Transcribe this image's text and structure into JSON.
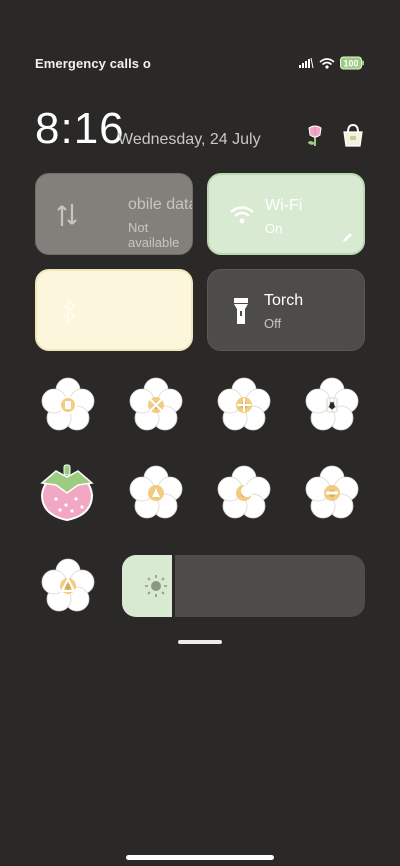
{
  "status": {
    "text": "Emergency calls o",
    "battery_label": "100"
  },
  "clock": {
    "time": "8:16",
    "date": "Wednesday, 24 July"
  },
  "tiles": {
    "mobile_data": {
      "label": "obile data",
      "sub": "Not available"
    },
    "wifi": {
      "label": "Wi-Fi",
      "sub": "On"
    },
    "bluetooth": {
      "label": "",
      "sub": ""
    },
    "torch": {
      "label": "Torch",
      "sub": "Off"
    }
  },
  "brightness": {
    "level_fraction": 0.22
  },
  "colors": {
    "background": "#2a2927",
    "wifi_tile": "#d9ead2",
    "bluetooth_tile": "#fcf6dc",
    "mobile_tile": "#82807a",
    "torch_tile": "#4d4c49",
    "flower_petal": "#ffffff",
    "flower_center": "#f0c46a",
    "strawberry": "#f2a7c3",
    "strawberry_leaf": "#9ccb82"
  },
  "quick_toggles": [
    {
      "icon": "power-saving-icon"
    },
    {
      "icon": "airplane-mode-icon"
    },
    {
      "icon": "location-icon"
    },
    {
      "icon": "screen-rotation-icon"
    },
    {
      "icon": "strawberry-sticker-icon"
    },
    {
      "icon": "hotspot-icon"
    },
    {
      "icon": "dark-mode-icon"
    },
    {
      "icon": "do-not-disturb-icon"
    },
    {
      "icon": "auto-brightness-icon"
    }
  ]
}
